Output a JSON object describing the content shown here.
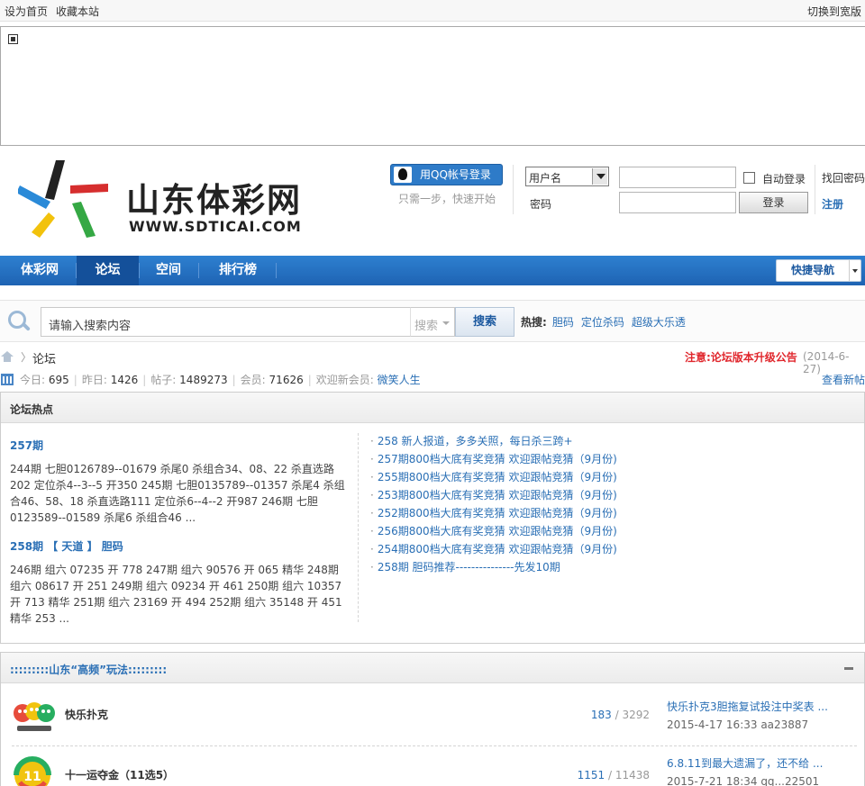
{
  "topbar": {
    "set_home": "设为首页",
    "bookmark": "收藏本站",
    "switch_width": "切换到宽版"
  },
  "header": {
    "logo_cn": "山东体彩网",
    "logo_en": "WWW.SDTICAI.COM",
    "qq_login": "用QQ帐号登录",
    "qq_sub": "只需一步，快速开始",
    "username_select": "用户名",
    "password_label": "密码",
    "auto_login": "自动登录",
    "login_button": "登录",
    "find_password": "找回密码",
    "register": "注册"
  },
  "nav": {
    "items": [
      {
        "label": "体彩网"
      },
      {
        "label": "论坛",
        "active": true
      },
      {
        "label": "空间"
      },
      {
        "label": "排行榜"
      }
    ],
    "quick_nav": "快捷导航"
  },
  "search": {
    "placeholder": "请输入搜索内容",
    "type": "搜索",
    "button": "搜索",
    "hot_label": "热搜:",
    "hot_terms": [
      "胆码",
      "定位杀码",
      "超级大乐透"
    ]
  },
  "breadcrumb": {
    "current": "论坛"
  },
  "notice": {
    "text": "注意:论坛版本升级公告",
    "date": "(2014-6-27)"
  },
  "stats": {
    "today_label": "今日:",
    "today": "695",
    "yesterday_label": "昨日:",
    "yesterday": "1426",
    "posts_label": "帖子:",
    "posts": "1489273",
    "members_label": "会员:",
    "members": "71626",
    "newest_label": "欢迎新会员:",
    "newest": "微笑人生",
    "view_new": "查看新帖"
  },
  "hotbox": {
    "title": "论坛热点",
    "featured": [
      {
        "title": "257期",
        "summary": "244期 七胆0126789--01679 杀尾0 杀组合34、08、22 杀直选路202 定位杀4--3--5 开350 245期 七胆0135789--01357 杀尾4 杀组合46、58、18 杀直选路111 定位杀6--4--2 开987 246期 七胆0123589--01589 杀尾6 杀组合46 ..."
      },
      {
        "title": "258期 【 天道 】 胆码",
        "summary": "246期 组六 07235 开 778 247期 组六 90576 开 065 精华 248期 组六 08617 开 251 249期 组六 09234 开 461 250期 组六 10357 开 713 精华 251期 组六 23169 开 494 252期 组六 35148 开 451 精华 253 ..."
      }
    ],
    "list": [
      "258 新人报道，多多关照，每日杀三跨+",
      "257期800档大底有奖竞猜 欢迎跟帖竞猜（9月份)",
      "255期800档大底有奖竞猜 欢迎跟帖竞猜（9月份)",
      "253期800档大底有奖竞猜 欢迎跟帖竞猜（9月份)",
      "252期800档大底有奖竞猜 欢迎跟帖竞猜（9月份)",
      "256期800档大底有奖竞猜 欢迎跟帖竞猜（9月份)",
      "254期800档大底有奖竞猜 欢迎跟帖竞猜（9月份)",
      "258期 胆码推荐---------------先发10期"
    ]
  },
  "section": {
    "title": ":::::::::山东“高频”玩法:::::::::",
    "forums": [
      {
        "name": "快乐扑克",
        "threads": "183",
        "sep": " / ",
        "posts": "3292",
        "last_title": "快乐扑克3胆拖复试投注中奖表 ...",
        "last_meta": "2015-4-17 16:33 aa23887"
      },
      {
        "name": "十一运夺金（11选5）",
        "threads": "1151",
        "sep": " / ",
        "posts": "11438",
        "last_title": "6.8.11到最大遗漏了，还不给 ...",
        "last_meta": "2015-7-21 18:34 qq...22501"
      }
    ]
  }
}
